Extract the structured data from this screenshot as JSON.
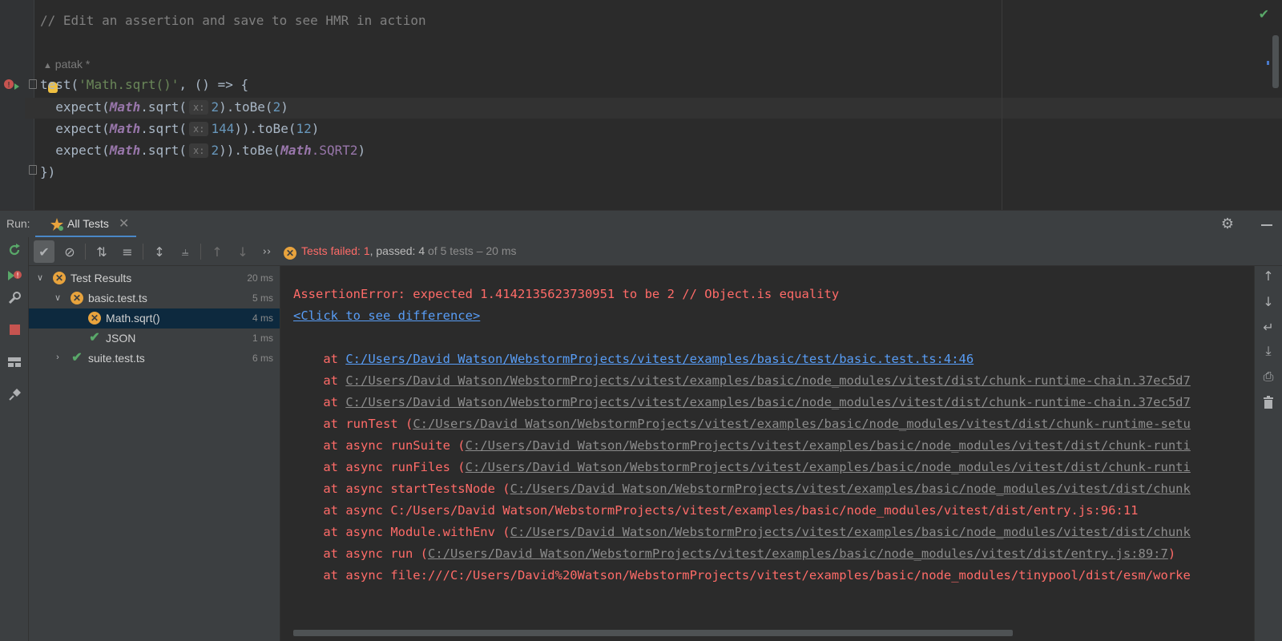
{
  "editor": {
    "comment": "// Edit an assertion and save to see HMR in action",
    "author": "patak *",
    "lines": [
      {
        "t1": "test(",
        "str": "'Math.sqrt()'",
        "t2": ", () => {"
      },
      {
        "t1": "  expect(",
        "glob": "Math",
        "t2": ".sqrt(",
        "hint": "x:",
        "num": "2",
        "t3": ").toBe(",
        "num2": "2",
        "t4": ")"
      },
      {
        "t1": "  expect(",
        "glob": "Math",
        "t2": ".sqrt(",
        "hint": "x:",
        "num": "144",
        "t3": ")).toBe(",
        "num2": "12",
        "t4": ")"
      },
      {
        "t1": "  expect(",
        "glob": "Math",
        "t2": ".sqrt(",
        "hint": "x:",
        "num": "2",
        "t3": ")).toBe(",
        "glob2": "Math",
        "prop": ".SQRT2",
        "t4": ")"
      },
      {
        "t1": "})"
      }
    ]
  },
  "run_window": {
    "label": "Run:",
    "tab_label": "All Tests",
    "status": {
      "failed": "Tests failed: 1",
      "passed": ", passed: 4",
      "rest": " of 5 tests – 20 ms"
    }
  },
  "tree": [
    {
      "label": "Test Results",
      "duration": "20 ms",
      "status": "fail"
    },
    {
      "label": "basic.test.ts",
      "duration": "5 ms",
      "status": "fail"
    },
    {
      "label": "Math.sqrt()",
      "duration": "4 ms",
      "status": "fail"
    },
    {
      "label": "JSON",
      "duration": "1 ms",
      "status": "pass"
    },
    {
      "label": "suite.test.ts",
      "duration": "6 ms",
      "status": "pass"
    }
  ],
  "console": {
    "error": "AssertionError: expected 1.4142135623730951 to be 2 // Object.is equality",
    "diff_link": "<Click to see difference>",
    "stack": [
      {
        "prefix": "    at ",
        "link": "C:/Users/David Watson/WebstormProjects/vitest/examples/basic/test/basic.test.ts:4:46",
        "suffix": "",
        "kind": "blue"
      },
      {
        "prefix": "    at ",
        "link": "C:/Users/David Watson/WebstormProjects/vitest/examples/basic/node_modules/vitest/dist/chunk-runtime-chain.37ec5d7",
        "suffix": "",
        "kind": "gray"
      },
      {
        "prefix": "    at ",
        "link": "C:/Users/David Watson/WebstormProjects/vitest/examples/basic/node_modules/vitest/dist/chunk-runtime-chain.37ec5d7",
        "suffix": "",
        "kind": "gray"
      },
      {
        "prefix": "    at runTest (",
        "link": "C:/Users/David Watson/WebstormProjects/vitest/examples/basic/node_modules/vitest/dist/chunk-runtime-setu",
        "suffix": "",
        "kind": "gray"
      },
      {
        "prefix": "    at async runSuite (",
        "link": "C:/Users/David Watson/WebstormProjects/vitest/examples/basic/node_modules/vitest/dist/chunk-runti",
        "suffix": "",
        "kind": "gray"
      },
      {
        "prefix": "    at async runFiles (",
        "link": "C:/Users/David Watson/WebstormProjects/vitest/examples/basic/node_modules/vitest/dist/chunk-runti",
        "suffix": "",
        "kind": "gray"
      },
      {
        "prefix": "    at async startTestsNode (",
        "link": "C:/Users/David Watson/WebstormProjects/vitest/examples/basic/node_modules/vitest/dist/chunk",
        "suffix": "",
        "kind": "gray"
      },
      {
        "prefix": "    at async C:/Users/David Watson/WebstormProjects/vitest/examples/basic/node_modules/vitest/dist/entry.js:96:11",
        "link": "",
        "suffix": "",
        "kind": "none"
      },
      {
        "prefix": "    at async Module.withEnv (",
        "link": "C:/Users/David Watson/WebstormProjects/vitest/examples/basic/node_modules/vitest/dist/chunk",
        "suffix": "",
        "kind": "gray"
      },
      {
        "prefix": "    at async run (",
        "link": "C:/Users/David Watson/WebstormProjects/vitest/examples/basic/node_modules/vitest/dist/entry.js:89:7",
        "suffix": ")",
        "kind": "gray"
      },
      {
        "prefix": "    at async file:///C:/Users/David%20Watson/WebstormProjects/vitest/examples/basic/node_modules/tinypool/dist/esm/worke",
        "link": "",
        "suffix": "",
        "kind": "none"
      }
    ]
  },
  "icons": {
    "rerun": "rerun-icon",
    "rerun_failed": "rerun-failed-icon",
    "settings": "wrench-icon",
    "stop": "stop-icon",
    "layout": "layout-icon",
    "pin": "pin-icon",
    "show_passed": "check-icon",
    "show_ignored": "ignored-icon",
    "sort_alpha": "sort-alpha-icon",
    "sort_duration": "sort-duration-icon",
    "expand_all": "expand-all-icon",
    "collapse_all": "collapse-all-icon",
    "prev_failed": "arrow-up-icon",
    "next_failed": "arrow-down-icon",
    "more": "more-icon"
  },
  "colors": {
    "error": "#ff6b68",
    "link": "#589df6",
    "pass": "#59a869",
    "fail": "#e8a33d",
    "selection": "#0d293e"
  }
}
